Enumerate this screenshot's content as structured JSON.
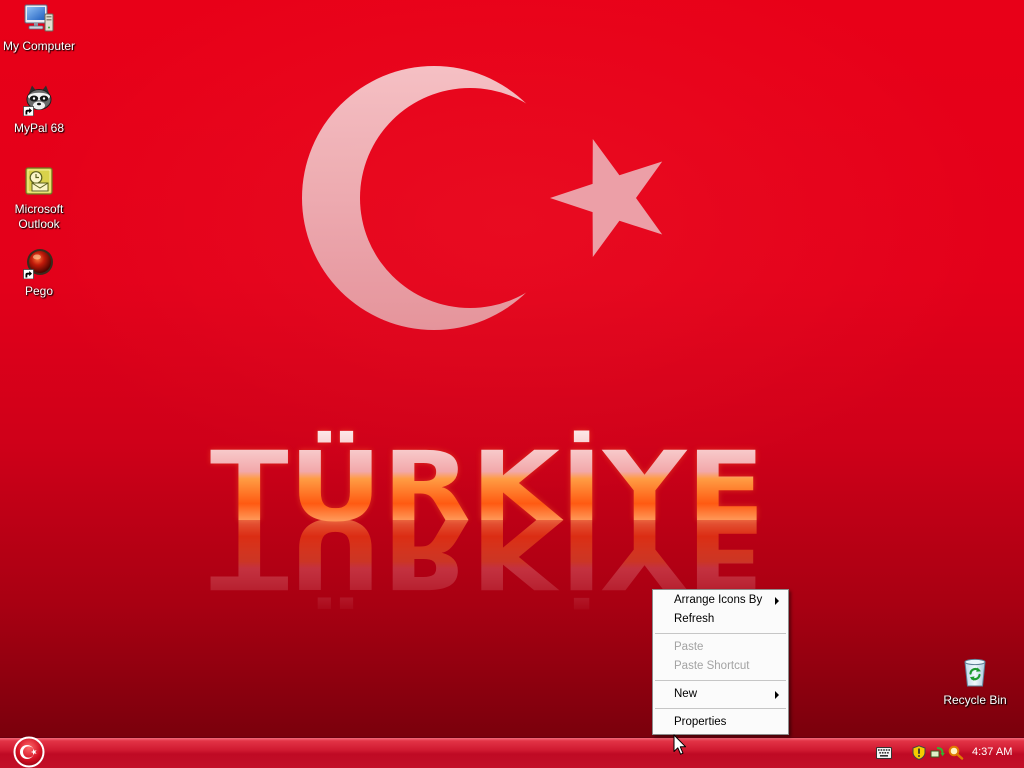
{
  "theme": {
    "wallpaper_top": "#e80018",
    "wallpaper_bottom": "#7a000c",
    "taskbar": "#c20f28",
    "symbol": "#f1b3b8",
    "menu_disabled_text": "#a3a3a3"
  },
  "desktop": {
    "wallpaper": {
      "text": "TÜRKİYE"
    },
    "icons": [
      {
        "label": "My Computer",
        "icon": "my-computer-icon",
        "shortcut": false
      },
      {
        "label": "MyPal 68",
        "icon": "mypal-browser-icon",
        "shortcut": true
      },
      {
        "label": "Microsoft Outlook",
        "icon": "outlook-icon",
        "shortcut": false
      },
      {
        "label": "Pego",
        "icon": "pego-icon",
        "shortcut": true
      }
    ],
    "recycle_bin": {
      "label": "Recycle Bin",
      "icon": "recycle-bin-icon"
    }
  },
  "context_menu": {
    "groups": [
      [
        {
          "label": "Arrange Icons By",
          "submenu": true,
          "enabled": true
        },
        {
          "label": "Refresh",
          "submenu": false,
          "enabled": true
        }
      ],
      [
        {
          "label": "Paste",
          "submenu": false,
          "enabled": false
        },
        {
          "label": "Paste Shortcut",
          "submenu": false,
          "enabled": false
        }
      ],
      [
        {
          "label": "New",
          "submenu": true,
          "enabled": true
        }
      ],
      [
        {
          "label": "Properties",
          "submenu": false,
          "enabled": true
        }
      ]
    ]
  },
  "taskbar": {
    "start_button": {
      "icon": "start-orb-icon"
    },
    "tray": {
      "icons": [
        "keyboard-icon",
        "security-shield-icon",
        "network-icon",
        "search-icon"
      ],
      "clock": "4:37 AM"
    }
  }
}
